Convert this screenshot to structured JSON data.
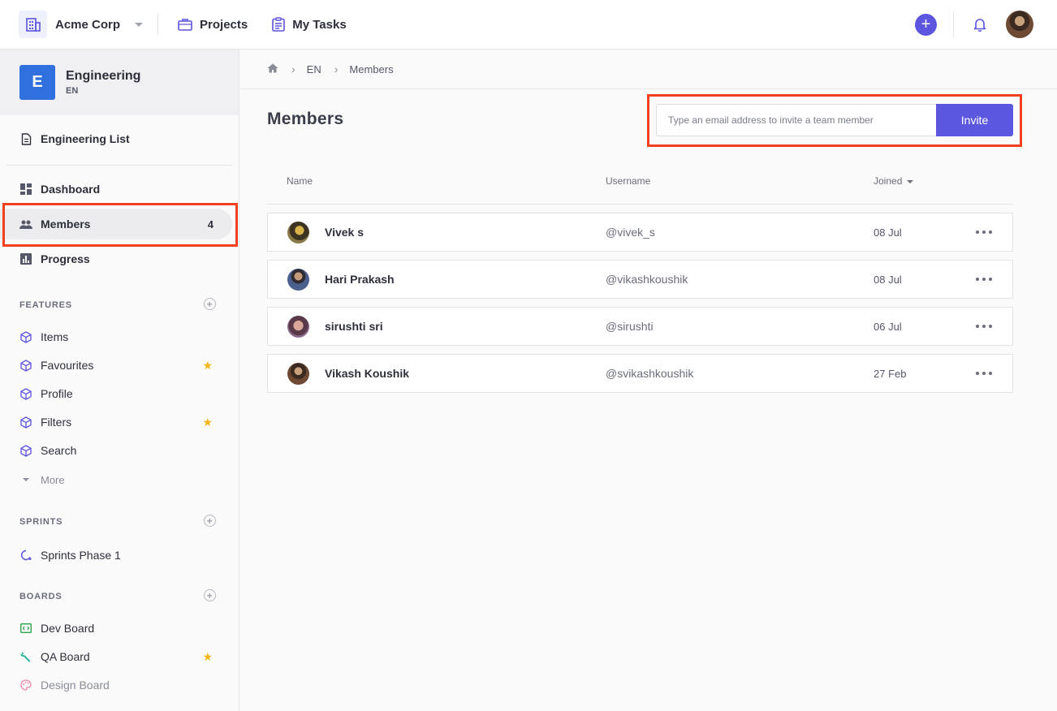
{
  "topbar": {
    "org_name": "Acme Corp",
    "nav": [
      {
        "label": "Projects",
        "icon": "briefcase-icon"
      },
      {
        "label": "My Tasks",
        "icon": "clipboard-icon"
      }
    ],
    "add_icon": "plus-icon",
    "accent": "#5b55df"
  },
  "sidebar": {
    "team_badge": "E",
    "team_name": "Engineering",
    "team_key": "EN",
    "list_link": "Engineering List",
    "nav": [
      {
        "label": "Dashboard",
        "icon": "dashboard-icon"
      },
      {
        "label": "Members",
        "icon": "people-icon",
        "count": "4"
      },
      {
        "label": "Progress",
        "icon": "chart-icon"
      }
    ],
    "features": {
      "title": "FEATURES",
      "items": [
        {
          "label": "Items",
          "starred": false
        },
        {
          "label": "Favourites",
          "starred": true
        },
        {
          "label": "Profile",
          "starred": false
        },
        {
          "label": "Filters",
          "starred": true
        },
        {
          "label": "Search",
          "starred": false
        }
      ],
      "more": "More"
    },
    "sprints": {
      "title": "SPRINTS",
      "items": [
        {
          "label": "Sprints Phase 1"
        }
      ]
    },
    "boards": {
      "title": "BOARDS",
      "items": [
        {
          "label": "Dev Board",
          "starred": false
        },
        {
          "label": "QA Board",
          "starred": true
        },
        {
          "label": "Design Board",
          "starred": false
        }
      ]
    }
  },
  "breadcrumb": {
    "items": [
      "EN",
      "Members"
    ]
  },
  "main": {
    "title": "Members",
    "invite": {
      "placeholder": "Type an email address to invite a team member",
      "button": "Invite"
    },
    "columns": [
      "Name",
      "Username",
      "Joined"
    ],
    "members": [
      {
        "name": "Vivek s",
        "username": "@vivek_s",
        "joined": "08 Jul"
      },
      {
        "name": "Hari Prakash",
        "username": "@vikashkoushik",
        "joined": "08 Jul"
      },
      {
        "name": "sirushti sri",
        "username": "@sirushti",
        "joined": "06 Jul"
      },
      {
        "name": "Vikash Koushik",
        "username": "@svikashkoushik",
        "joined": "27 Feb"
      }
    ]
  }
}
